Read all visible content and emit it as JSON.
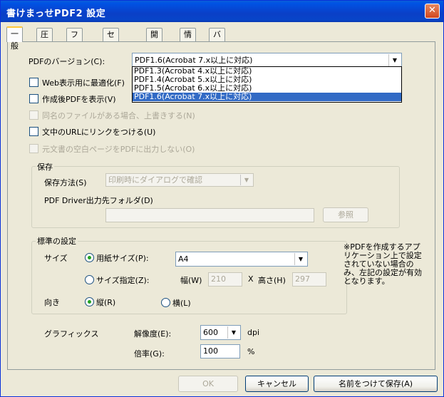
{
  "window": {
    "title": "書けまっせPDF2 設定",
    "close_glyph": "✕"
  },
  "tabs": [
    "一般",
    "圧縮",
    "フォント",
    "セキュリティ",
    "開き方",
    "情報",
    "バージョン"
  ],
  "general": {
    "pdf_version_label": "PDFのバージョン(C):",
    "pdf_version_value": "PDF1.6(Acrobat 7.x以上に対応)",
    "version_options": [
      "PDF1.3(Acrobat 4.x以上に対応)",
      "PDF1.4(Acrobat 5.x以上に対応)",
      "PDF1.5(Acrobat 6.x以上に対応)",
      "PDF1.6(Acrobat 7.x以上に対応)"
    ],
    "web_optimize": "Web表示用に最適化(F)",
    "show_after": "作成後PDFを表示(V)",
    "overwrite": "同名のファイルがある場合、上書きする(N)",
    "url_link": "文中のURLにリンクをつける(U)",
    "blank_page": "元文書の空白ページをPDFに出力しない(O)"
  },
  "save_group": {
    "title": "保存",
    "method_label": "保存方法(S)",
    "method_value": "印刷時にダイアログで確認",
    "folder_label": "PDF Driver出力先フォルダ(D)",
    "browse": "参照"
  },
  "standard_group": {
    "title": "標準の設定",
    "size_label": "サイズ",
    "paper_size_radio": "用紙サイズ(P):",
    "paper_size_value": "A4",
    "custom_size_radio": "サイズ指定(Z):",
    "width_label": "幅(W)",
    "width_value": "210",
    "x_label": "X",
    "height_label": "高さ(H)",
    "height_value": "297",
    "orientation_label": "向き",
    "portrait": "縦(R)",
    "landscape": "横(L)"
  },
  "note": "※PDFを作成するアプリケーション上で設定されていない場合のみ、左記の設定が有効となります。",
  "graphics": {
    "label": "グラフィックス",
    "resolution_label": "解像度(E):",
    "resolution_value": "600",
    "resolution_unit": "dpi",
    "scale_label": "倍率(G):",
    "scale_value": "100",
    "scale_unit": "%"
  },
  "buttons": {
    "ok": "OK",
    "cancel": "キャンセル",
    "save_as": "名前をつけて保存(A)"
  },
  "colors": {
    "title_bar": "#0A3FC7",
    "selection": "#316AC5",
    "dialog_bg": "#ECE9D8"
  }
}
